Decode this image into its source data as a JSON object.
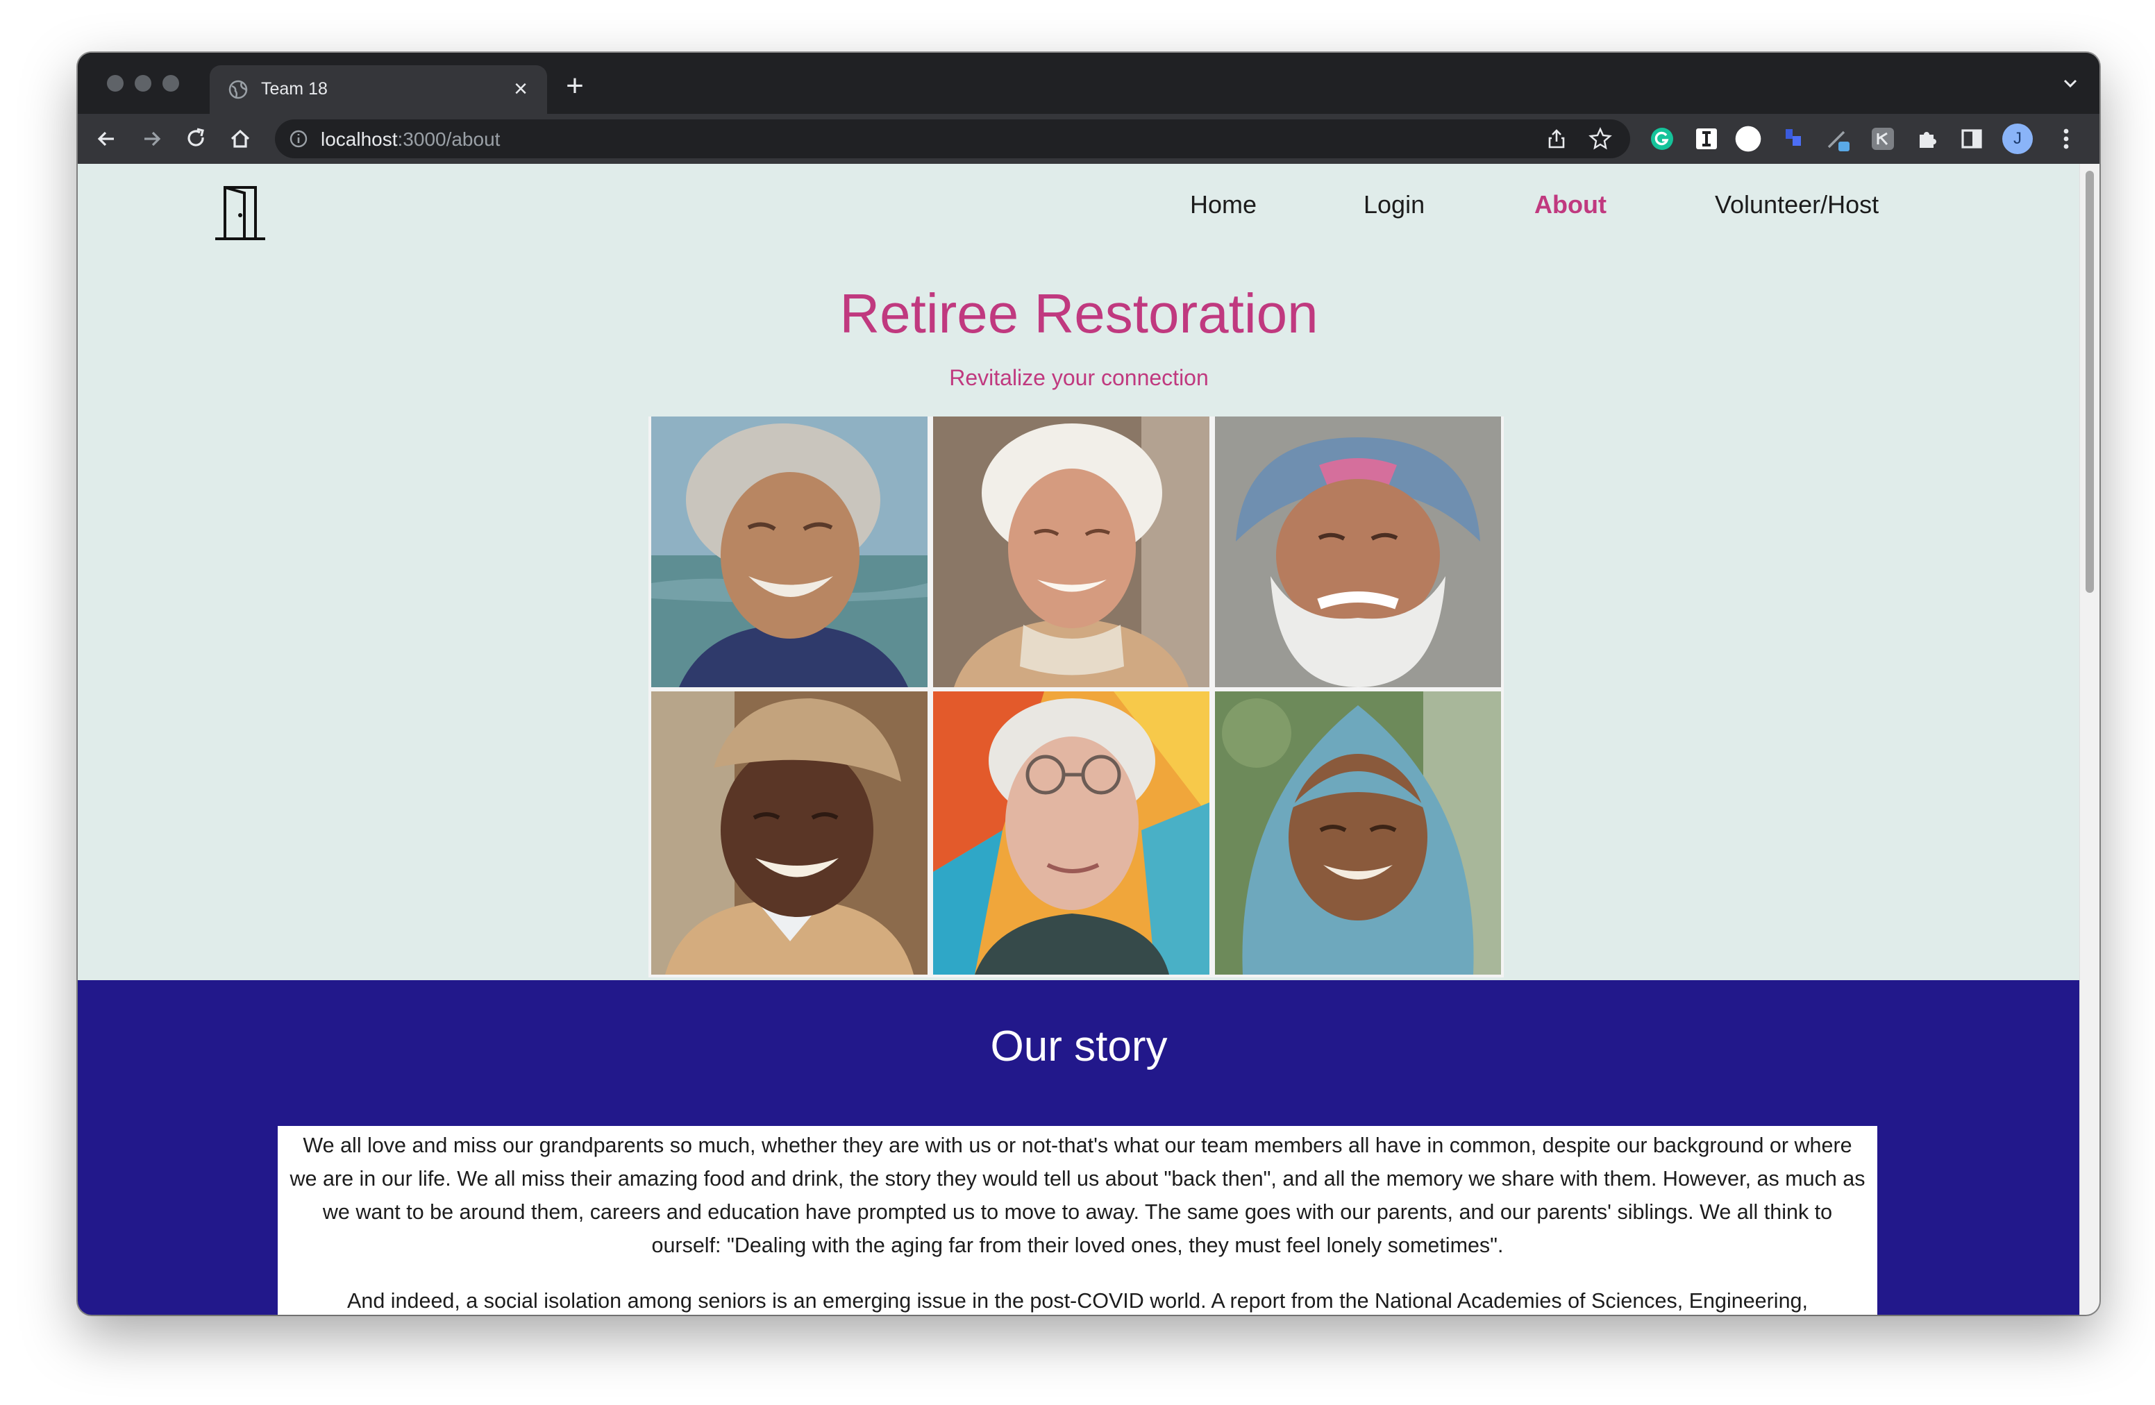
{
  "browser": {
    "tab_title": "Team 18",
    "url_host": "localhost",
    "url_path": ":3000/about",
    "profile_initial": "J"
  },
  "nav": {
    "items": [
      {
        "label": "Home",
        "active": false
      },
      {
        "label": "Login",
        "active": false
      },
      {
        "label": "About",
        "active": true
      },
      {
        "label": "Volunteer/Host",
        "active": false
      }
    ]
  },
  "hero": {
    "title": "Retiree Restoration",
    "subtitle": "Revitalize your connection"
  },
  "story": {
    "title": "Our story",
    "paragraphs": [
      "We all love and miss our grandparents so much, whether they are with us or not-that's what our team members all have in common, despite our background or where we are in our life. We all miss their amazing food and drink, the story they would tell us about \"back then\", and all the memory we share with them. However, as much as we want to be around them, careers and education have prompted us to move to away. The same goes with our parents, and our parents' siblings. We all think to ourself: \"Dealing with the aging far from their loved ones, they must feel lonely sometimes\".",
      "And indeed, a social isolation among seniors is an emerging issue in the post-COVID world. A report from the National Academies of Sciences, Engineering,"
    ]
  },
  "colors": {
    "accent": "#c0397f",
    "page_bg": "#e0ecea",
    "story_bg": "#22188b"
  }
}
